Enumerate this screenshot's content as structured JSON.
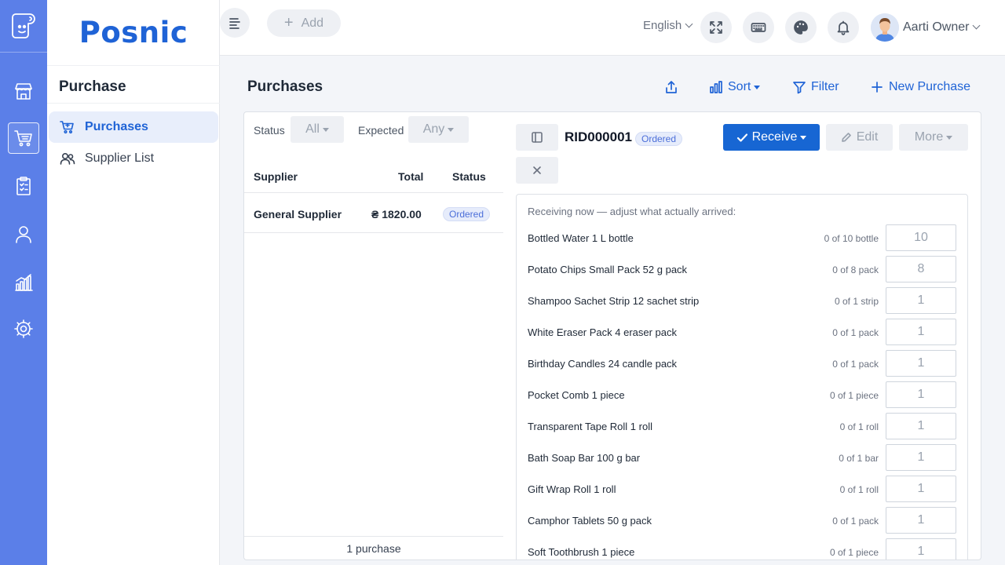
{
  "app": {
    "brand": "Posnic"
  },
  "rail": {
    "items": [
      {
        "icon": "store-icon",
        "active": false
      },
      {
        "icon": "cart-icon",
        "active": true
      },
      {
        "icon": "clipboard-icon",
        "active": false
      },
      {
        "icon": "user-icon",
        "active": false
      },
      {
        "icon": "bar-chart-icon",
        "active": false
      },
      {
        "icon": "gear-icon",
        "active": false
      }
    ]
  },
  "sidebar": {
    "section_title": "Purchase",
    "items": [
      {
        "label": "Purchases",
        "active": true
      },
      {
        "label": "Supplier List",
        "active": false
      }
    ]
  },
  "topbar": {
    "add_label": "Add",
    "language": "English",
    "user_name": "Aarti Owner"
  },
  "page": {
    "title": "Purchases",
    "sort_label": "Sort",
    "filter_label": "Filter",
    "new_label": "New Purchase"
  },
  "list": {
    "status_label": "Status",
    "status_value": "All",
    "expected_label": "Expected",
    "expected_value": "Any",
    "columns": [
      "Supplier",
      "Total",
      "Status"
    ],
    "rows": [
      {
        "supplier": "General Supplier",
        "total": "₴ 1820.00",
        "status": "Ordered"
      }
    ],
    "footer": "1 purchase"
  },
  "detail": {
    "rid": "RID000001",
    "status": "Ordered",
    "receive_label": "Receive",
    "edit_label": "Edit",
    "more_label": "More",
    "note": "Receiving now — adjust what actually arrived:",
    "items": [
      {
        "name": "Bottled Water 1 L bottle",
        "count": "0 of 10 bottle",
        "qty": "10"
      },
      {
        "name": "Potato Chips Small Pack 52 g pack",
        "count": "0 of 8 pack",
        "qty": "8"
      },
      {
        "name": "Shampoo Sachet Strip 12 sachet strip",
        "count": "0 of 1 strip",
        "qty": "1"
      },
      {
        "name": "White Eraser Pack 4 eraser pack",
        "count": "0 of 1 pack",
        "qty": "1"
      },
      {
        "name": "Birthday Candles 24 candle pack",
        "count": "0 of 1 pack",
        "qty": "1"
      },
      {
        "name": "Pocket Comb 1 piece",
        "count": "0 of 1 piece",
        "qty": "1"
      },
      {
        "name": "Transparent Tape Roll 1 roll",
        "count": "0 of 1 roll",
        "qty": "1"
      },
      {
        "name": "Bath Soap Bar 100 g bar",
        "count": "0 of 1 bar",
        "qty": "1"
      },
      {
        "name": "Gift Wrap Roll 1 roll",
        "count": "0 of 1 roll",
        "qty": "1"
      },
      {
        "name": "Camphor Tablets 50 g pack",
        "count": "0 of 1 pack",
        "qty": "1"
      },
      {
        "name": "Soft Toothbrush 1 piece",
        "count": "0 of 1 piece",
        "qty": "1"
      }
    ]
  },
  "colors": {
    "rail": "#5b7fe8",
    "accent": "#1f63d6",
    "primary_button": "#1766d3"
  }
}
